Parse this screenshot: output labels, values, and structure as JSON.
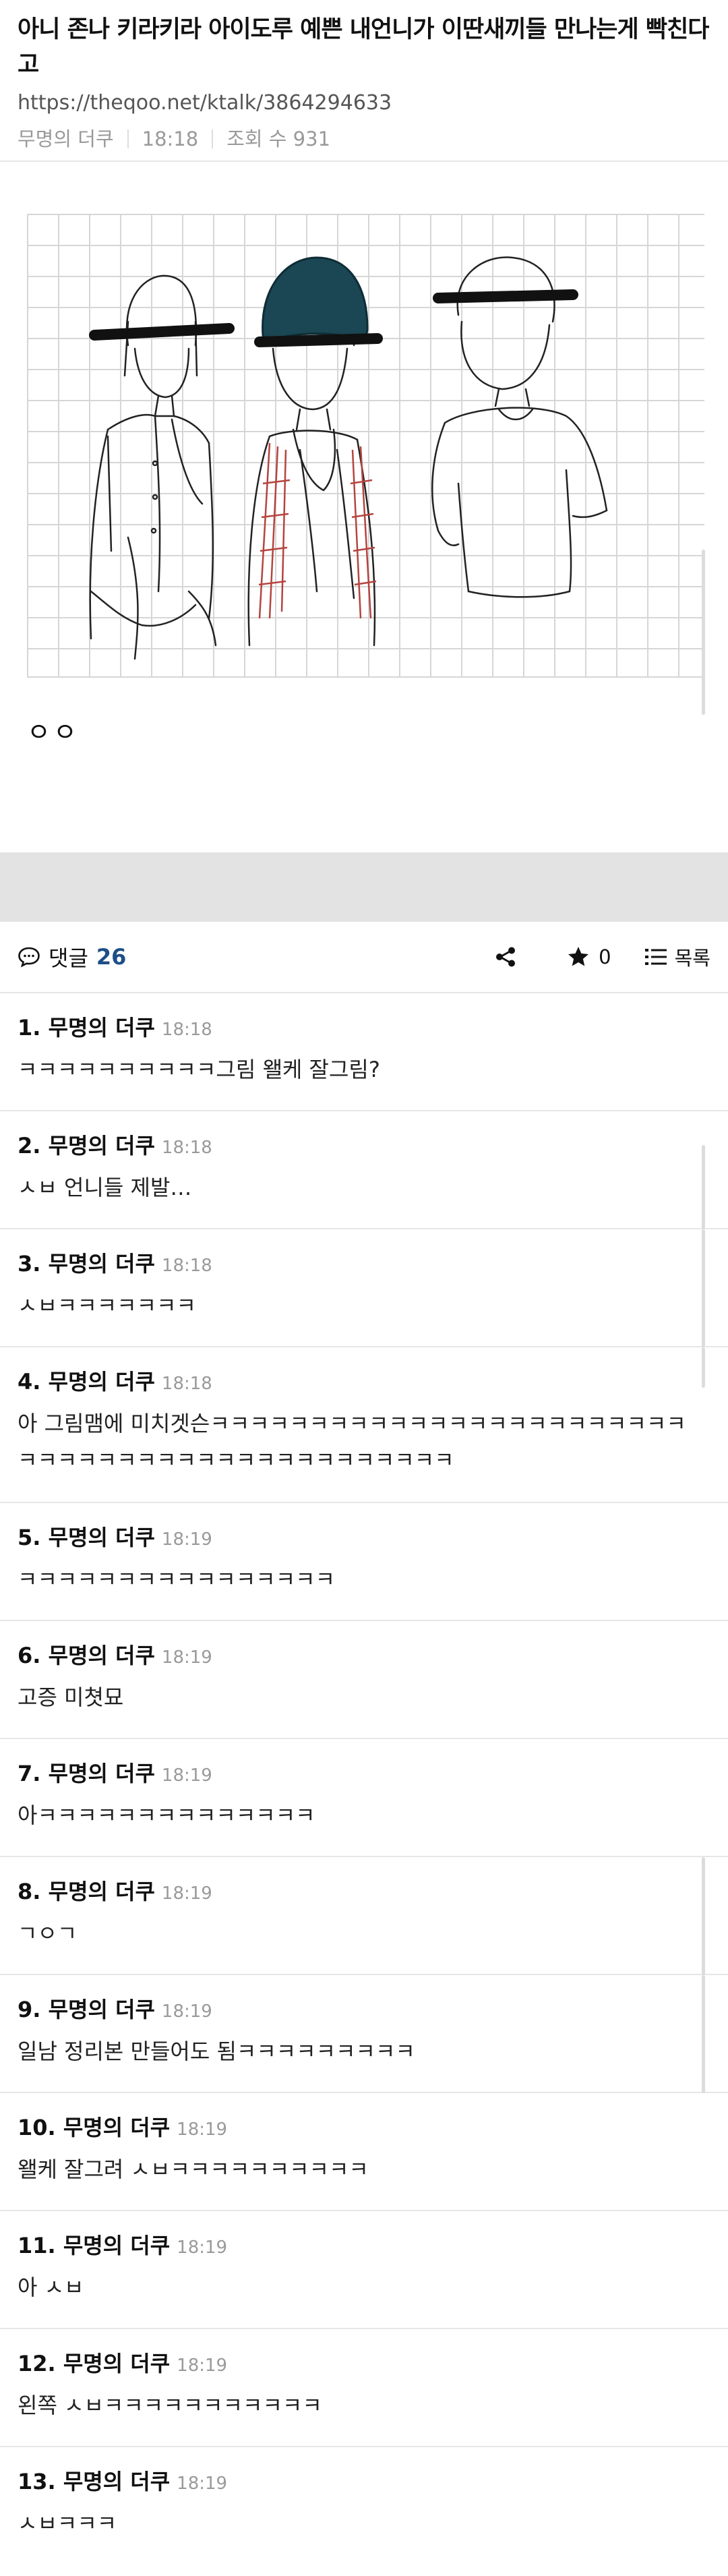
{
  "post": {
    "title": "아니 존나 키라키라 아이도루 예쁜 내언니가 이딴새끼들 만나는게 빡친다고",
    "url": "https://theqoo.net/ktalk/3864294633",
    "author": "무명의 더쿠",
    "time": "18:18",
    "views": "조회 수 931",
    "body_text": "ㅇㅇ"
  },
  "toolbar": {
    "comments_label": "댓글",
    "comments_count": "26",
    "like_count": "0",
    "list_label": "목록"
  },
  "icons": {
    "comment": "speech-bubble-icon",
    "share": "share-icon",
    "like": "star-icon",
    "list": "list-icon"
  },
  "comments": [
    {
      "num": "1.",
      "author": "무명의 더쿠",
      "time": "18:18",
      "text": "ㅋㅋㅋㅋㅋㅋㅋㅋㅋㅋ그림 왤케 잘그림?"
    },
    {
      "num": "2.",
      "author": "무명의 더쿠",
      "time": "18:18",
      "text": "ㅅㅂ 언니들 제발…"
    },
    {
      "num": "3.",
      "author": "무명의 더쿠",
      "time": "18:18",
      "text": "ㅅㅂㅋㅋㅋㅋㅋㅋㅋ"
    },
    {
      "num": "4.",
      "author": "무명의 더쿠",
      "time": "18:18",
      "text": "아 그림맴에 미치겟슨ㅋㅋㅋㅋㅋㅋㅋㅋㅋㅋㅋㅋㅋㅋㅋㅋㅋㅋㅋㅋㅋㅋㅋㅋㅋㅋㅋㅋㅋㅋㅋㅋㅋㅋㅋㅋㅋㅋㅋㅋㅋㅋㅋㅋㅋㅋ"
    },
    {
      "num": "5.",
      "author": "무명의 더쿠",
      "time": "18:19",
      "text": "ㅋㅋㅋㅋㅋㅋㅋㅋㅋㅋㅋㅋㅋㅋㅋㅋ"
    },
    {
      "num": "6.",
      "author": "무명의 더쿠",
      "time": "18:19",
      "text": "고증 미쳣묘"
    },
    {
      "num": "7.",
      "author": "무명의 더쿠",
      "time": "18:19",
      "text": "아ㅋㅋㅋㅋㅋㅋㅋㅋㅋㅋㅋㅋㅋㅋ"
    },
    {
      "num": "8.",
      "author": "무명의 더쿠",
      "time": "18:19",
      "text": "ㄱㅇㄱ"
    },
    {
      "num": "9.",
      "author": "무명의 더쿠",
      "time": "18:19",
      "text": "일남 정리본 만들어도 됨ㅋㅋㅋㅋㅋㅋㅋㅋㅋ"
    },
    {
      "num": "10.",
      "author": "무명의 더쿠",
      "time": "18:19",
      "text": "왤케 잘그려 ㅅㅂㅋㅋㅋㅋㅋㅋㅋㅋㅋㅋ"
    },
    {
      "num": "11.",
      "author": "무명의 더쿠",
      "time": "18:19",
      "text": "아 ㅅㅂ"
    },
    {
      "num": "12.",
      "author": "무명의 더쿠",
      "time": "18:19",
      "text": "왼쪽 ㅅㅂㅋㅋㅋㅋㅋㅋㅋㅋㅋㅋㅋ"
    },
    {
      "num": "13.",
      "author": "무명의 더쿠",
      "time": "18:19",
      "text": "ㅅㅂㅋㅋㅋ"
    }
  ],
  "colors": {
    "accent": "#1d4f86",
    "meta_gray": "#999999",
    "divider": "#e6e6e6",
    "band": "#e3e3e3"
  }
}
